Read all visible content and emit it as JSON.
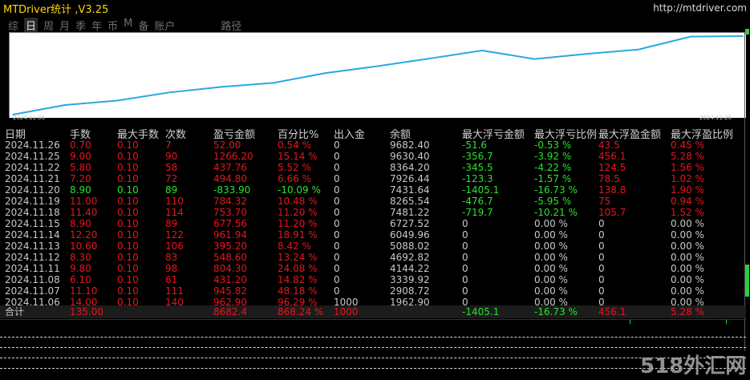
{
  "app": {
    "title": "MTDriver统计 ,V3.25",
    "url": "http://mtdriver.com",
    "watermark": "518外汇网"
  },
  "tabs": [
    {
      "label": "综",
      "active": false
    },
    {
      "label": "日",
      "active": true
    },
    {
      "label": "周",
      "active": false
    },
    {
      "label": "月",
      "active": false
    },
    {
      "label": "季",
      "active": false
    },
    {
      "label": "年",
      "active": false
    },
    {
      "label": "币",
      "active": false
    },
    {
      "label": "M",
      "active": false
    },
    {
      "label": "备",
      "active": false
    },
    {
      "label": "账户",
      "active": false
    },
    {
      "label": "路径",
      "active": false
    }
  ],
  "chart_data": {
    "type": "line",
    "x_start": "2024.11.06",
    "x_end": "2024.11.26",
    "x": [
      "2024.11.06",
      "2024.11.07",
      "2024.11.08",
      "2024.11.11",
      "2024.11.12",
      "2024.11.13",
      "2024.11.14",
      "2024.11.15",
      "2024.11.18",
      "2024.11.19",
      "2024.11.20",
      "2024.11.21",
      "2024.11.22",
      "2024.11.25",
      "2024.11.26"
    ],
    "y": [
      1962.9,
      2908.72,
      3339.92,
      4144.22,
      4692.82,
      5088.02,
      6049.96,
      6727.52,
      7481.22,
      8265.54,
      7431.64,
      7926.44,
      8364.2,
      9630.4,
      9682.4
    ],
    "line_color": "#29a8e0",
    "background": "#ffffff"
  },
  "table": {
    "headers": [
      "日期",
      "手数",
      "最大手数",
      "次数",
      "盈亏金额",
      "百分比%",
      "出入金",
      "余额",
      "最大浮亏金额",
      "最大浮亏比例",
      "最大浮盈金额",
      "最大浮盈比例"
    ],
    "rows": [
      {
        "date": "2024.11.26",
        "lots": "0.70",
        "maxlots": "0.10",
        "count": "7",
        "pl": "52.00",
        "pct": "0.54 %",
        "io": "0",
        "bal": "9682.40",
        "mfl": "-51.6",
        "mflp": "-0.53 %",
        "mfp": "43.5",
        "mfpp": "0.45 %",
        "sign": "pos"
      },
      {
        "date": "2024.11.25",
        "lots": "9.00",
        "maxlots": "0.10",
        "count": "90",
        "pl": "1266.20",
        "pct": "15.14 %",
        "io": "0",
        "bal": "9630.40",
        "mfl": "-356.7",
        "mflp": "-3.92 %",
        "mfp": "456.1",
        "mfpp": "5.28 %",
        "sign": "pos"
      },
      {
        "date": "2024.11.22",
        "lots": "5.80",
        "maxlots": "0.10",
        "count": "58",
        "pl": "437.76",
        "pct": "5.52 %",
        "io": "0",
        "bal": "8364.20",
        "mfl": "-345.5",
        "mflp": "-4.22 %",
        "mfp": "124.5",
        "mfpp": "1.56 %",
        "sign": "pos"
      },
      {
        "date": "2024.11.21",
        "lots": "7.20",
        "maxlots": "0.10",
        "count": "72",
        "pl": "494.80",
        "pct": "6.66 %",
        "io": "0",
        "bal": "7926.44",
        "mfl": "-123.3",
        "mflp": "-1.57 %",
        "mfp": "78.5",
        "mfpp": "1.02 %",
        "sign": "pos"
      },
      {
        "date": "2024.11.20",
        "lots": "8.90",
        "maxlots": "0.10",
        "count": "89",
        "pl": "-833.90",
        "pct": "-10.09 %",
        "io": "0",
        "bal": "7431.64",
        "mfl": "-1405.1",
        "mflp": "-16.73 %",
        "mfp": "138.8",
        "mfpp": "1.90 %",
        "sign": "neg"
      },
      {
        "date": "2024.11.19",
        "lots": "11.00",
        "maxlots": "0.10",
        "count": "110",
        "pl": "784.32",
        "pct": "10.48 %",
        "io": "0",
        "bal": "8265.54",
        "mfl": "-476.7",
        "mflp": "-5.95 %",
        "mfp": "75",
        "mfpp": "0.94 %",
        "sign": "pos"
      },
      {
        "date": "2024.11.18",
        "lots": "11.40",
        "maxlots": "0.10",
        "count": "114",
        "pl": "753.70",
        "pct": "11.20 %",
        "io": "0",
        "bal": "7481.22",
        "mfl": "-719.7",
        "mflp": "-10.21 %",
        "mfp": "105.7",
        "mfpp": "1.52 %",
        "sign": "pos"
      },
      {
        "date": "2024.11.15",
        "lots": "8.90",
        "maxlots": "0.10",
        "count": "89",
        "pl": "677.56",
        "pct": "11.20 %",
        "io": "0",
        "bal": "6727.52",
        "mfl": "0",
        "mflp": "0.00 %",
        "mfp": "0",
        "mfpp": "0.00 %",
        "sign": "pos"
      },
      {
        "date": "2024.11.14",
        "lots": "12.20",
        "maxlots": "0.10",
        "count": "122",
        "pl": "961.94",
        "pct": "18.91 %",
        "io": "0",
        "bal": "6049.96",
        "mfl": "0",
        "mflp": "0.00 %",
        "mfp": "0",
        "mfpp": "0.00 %",
        "sign": "pos"
      },
      {
        "date": "2024.11.13",
        "lots": "10.60",
        "maxlots": "0.10",
        "count": "106",
        "pl": "395.20",
        "pct": "8.42 %",
        "io": "0",
        "bal": "5088.02",
        "mfl": "0",
        "mflp": "0.00 %",
        "mfp": "0",
        "mfpp": "0.00 %",
        "sign": "pos"
      },
      {
        "date": "2024.11.12",
        "lots": "8.30",
        "maxlots": "0.10",
        "count": "83",
        "pl": "548.60",
        "pct": "13.24 %",
        "io": "0",
        "bal": "4692.82",
        "mfl": "0",
        "mflp": "0.00 %",
        "mfp": "0",
        "mfpp": "0.00 %",
        "sign": "pos"
      },
      {
        "date": "2024.11.11",
        "lots": "9.80",
        "maxlots": "0.10",
        "count": "98",
        "pl": "804.30",
        "pct": "24.08 %",
        "io": "0",
        "bal": "4144.22",
        "mfl": "0",
        "mflp": "0.00 %",
        "mfp": "0",
        "mfpp": "0.00 %",
        "sign": "pos"
      },
      {
        "date": "2024.11.08",
        "lots": "6.10",
        "maxlots": "0.10",
        "count": "61",
        "pl": "431.20",
        "pct": "14.82 %",
        "io": "0",
        "bal": "3339.92",
        "mfl": "0",
        "mflp": "0.00 %",
        "mfp": "0",
        "mfpp": "0.00 %",
        "sign": "pos"
      },
      {
        "date": "2024.11.07",
        "lots": "11.10",
        "maxlots": "0.10",
        "count": "111",
        "pl": "945.82",
        "pct": "48.18 %",
        "io": "0",
        "bal": "2908.72",
        "mfl": "0",
        "mflp": "0.00 %",
        "mfp": "0",
        "mfpp": "0.00 %",
        "sign": "pos"
      },
      {
        "date": "2024.11.06",
        "lots": "14.00",
        "maxlots": "0.10",
        "count": "140",
        "pl": "962.90",
        "pct": "96.29 %",
        "io": "1000",
        "bal": "1962.90",
        "mfl": "0",
        "mflp": "0.00 %",
        "mfp": "0",
        "mfpp": "0.00 %",
        "sign": "pos"
      }
    ],
    "total": {
      "label": "合计",
      "lots": "135.00",
      "pl": "8682.4",
      "pct": "868.24 %",
      "io": "1000",
      "mfl": "-1405.1",
      "mflp": "-16.73 %",
      "mfp": "456.1",
      "mfpp": "5.28 %"
    }
  },
  "colors": {
    "positive": "#e5161d",
    "negative": "#2ee02e",
    "header": "#d0d0d0",
    "accent": "#29a8e0",
    "title": "#ffd700"
  }
}
